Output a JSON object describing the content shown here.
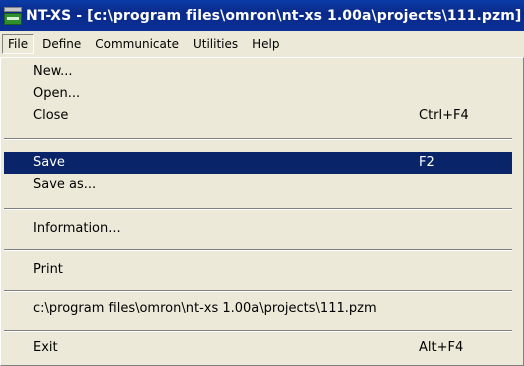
{
  "window": {
    "title": "NT-XS - [c:\\program files\\omron\\nt-xs 1.00a\\projects\\111.pzm]"
  },
  "menubar": {
    "items": [
      {
        "label": "File",
        "active": true
      },
      {
        "label": "Define"
      },
      {
        "label": "Communicate"
      },
      {
        "label": "Utilities"
      },
      {
        "label": "Help"
      }
    ]
  },
  "file_menu": {
    "new": {
      "label": "New..."
    },
    "open": {
      "label": "Open..."
    },
    "close": {
      "label": "Close",
      "shortcut": "Ctrl+F4"
    },
    "save": {
      "label": "Save",
      "shortcut": "F2",
      "selected": true
    },
    "save_as": {
      "label": "Save as..."
    },
    "information": {
      "label": "Information..."
    },
    "print": {
      "label": "Print"
    },
    "recent_file": {
      "label": "c:\\program files\\omron\\nt-xs 1.00a\\projects\\111.pzm"
    },
    "exit": {
      "label": "Exit",
      "shortcut": "Alt+F4"
    }
  },
  "colors": {
    "title_bar": "#0a2a8a",
    "selection": "#0a246a",
    "menu_bg": "#ece9d8"
  }
}
